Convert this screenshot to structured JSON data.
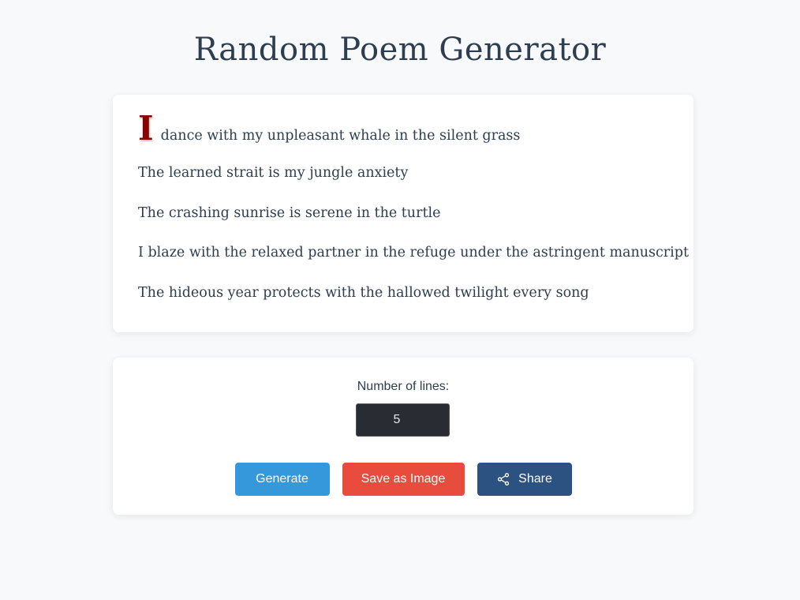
{
  "header": {
    "title": "Random Poem Generator"
  },
  "poem": {
    "drop_cap": "I",
    "first_line_rest": "dance with my unpleasant whale in the silent grass",
    "lines": [
      "The learned strait is my jungle anxiety",
      "The crashing sunrise is serene in the turtle",
      "I blaze with the relaxed partner in the refuge under the astringent manuscript",
      "The hideous year protects with the hallowed twilight every song"
    ]
  },
  "controls": {
    "lines_label": "Number of lines:",
    "lines_value": "5",
    "generate_label": "Generate",
    "save_label": "Save as Image",
    "share_label": "Share"
  },
  "colors": {
    "generate": "#3498db",
    "save": "#e74c3c",
    "share": "#2c5282",
    "drop_cap": "#8b0000"
  },
  "icons": {
    "share": "share-icon"
  }
}
